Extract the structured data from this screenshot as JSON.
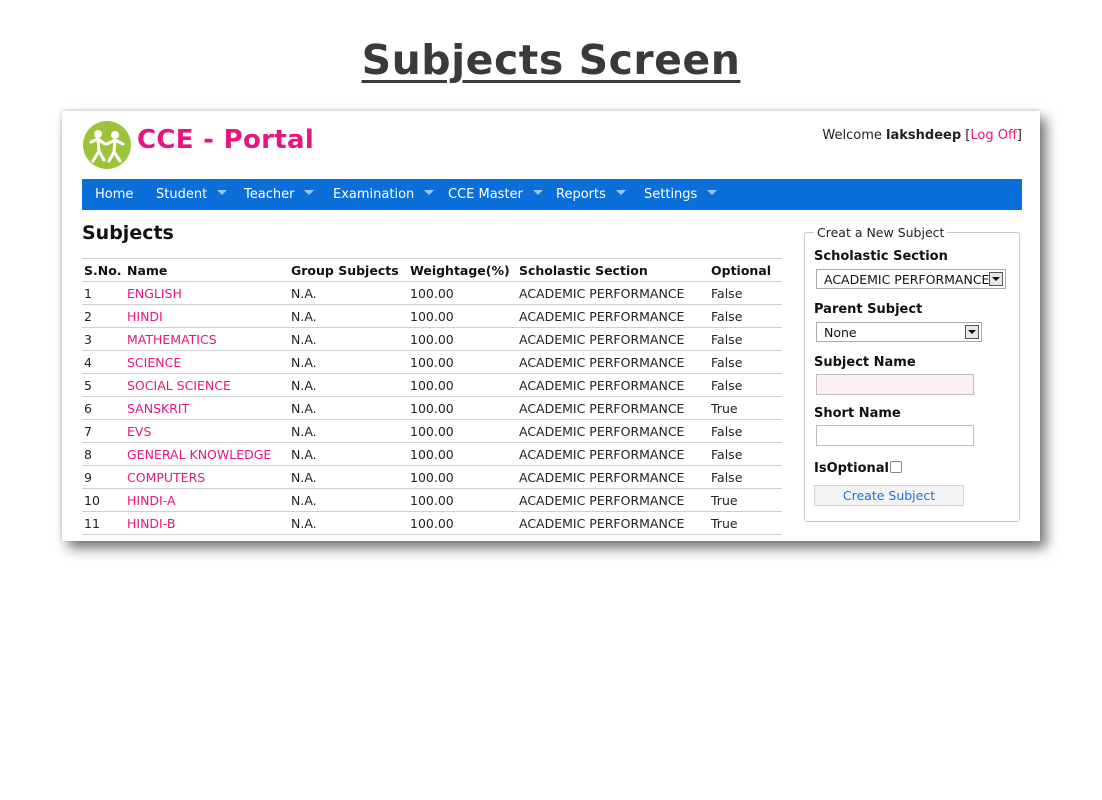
{
  "page_heading": "Subjects Screen",
  "app": {
    "brand": "CCE - Portal",
    "welcome_prefix": "Welcome",
    "username": "lakshdeep",
    "bracket_open": "[",
    "logoff_label": "Log Off",
    "bracket_close": "]"
  },
  "nav": {
    "items": [
      {
        "label": "Home"
      },
      {
        "label": "Student"
      },
      {
        "label": "Teacher"
      },
      {
        "label": "Examination"
      },
      {
        "label": "CCE Master"
      },
      {
        "label": "Reports"
      },
      {
        "label": "Settings"
      }
    ]
  },
  "subjects": {
    "title": "Subjects",
    "columns": [
      "S.No.",
      "Name",
      "Group Subjects",
      "Weightage(%)",
      "Scholastic Section",
      "Optional"
    ],
    "rows": [
      [
        "1",
        "ENGLISH",
        "N.A.",
        "100.00",
        "ACADEMIC PERFORMANCE",
        "False"
      ],
      [
        "2",
        "HINDI",
        "N.A.",
        "100.00",
        "ACADEMIC PERFORMANCE",
        "False"
      ],
      [
        "3",
        "MATHEMATICS",
        "N.A.",
        "100.00",
        "ACADEMIC PERFORMANCE",
        "False"
      ],
      [
        "4",
        "SCIENCE",
        "N.A.",
        "100.00",
        "ACADEMIC PERFORMANCE",
        "False"
      ],
      [
        "5",
        "SOCIAL SCIENCE",
        "N.A.",
        "100.00",
        "ACADEMIC PERFORMANCE",
        "False"
      ],
      [
        "6",
        "SANSKRIT",
        "N.A.",
        "100.00",
        "ACADEMIC PERFORMANCE",
        "True"
      ],
      [
        "7",
        "EVS",
        "N.A.",
        "100.00",
        "ACADEMIC PERFORMANCE",
        "False"
      ],
      [
        "8",
        "GENERAL KNOWLEDGE",
        "N.A.",
        "100.00",
        "ACADEMIC PERFORMANCE",
        "False"
      ],
      [
        "9",
        "COMPUTERS",
        "N.A.",
        "100.00",
        "ACADEMIC PERFORMANCE",
        "False"
      ],
      [
        "10",
        "HINDI-A",
        "N.A.",
        "100.00",
        "ACADEMIC PERFORMANCE",
        "True"
      ],
      [
        "11",
        "HINDI-B",
        "N.A.",
        "100.00",
        "ACADEMIC PERFORMANCE",
        "True"
      ]
    ]
  },
  "form": {
    "legend": "Creat a New Subject",
    "scholastic_label": "Scholastic Section",
    "scholastic_value": "ACADEMIC PERFORMANCE",
    "parent_label": "Parent Subject",
    "parent_value": "None",
    "name_label": "Subject Name",
    "name_value": "",
    "short_label": "Short Name",
    "short_value": "",
    "optional_label": "IsOptional",
    "optional_checked": false,
    "submit_label": "Create Subject"
  },
  "colors": {
    "brand_pink": "#e6167e",
    "nav_blue": "#0a6fd8",
    "logo_green": "#9cc33a",
    "required_field_bg": "#fdeef6",
    "button_text_blue": "#1a73d6"
  },
  "icons": {
    "logo": "people-dancing-logo-icon",
    "dropdown": "caret-down-icon",
    "select_toggle": "select-arrow-icon"
  }
}
